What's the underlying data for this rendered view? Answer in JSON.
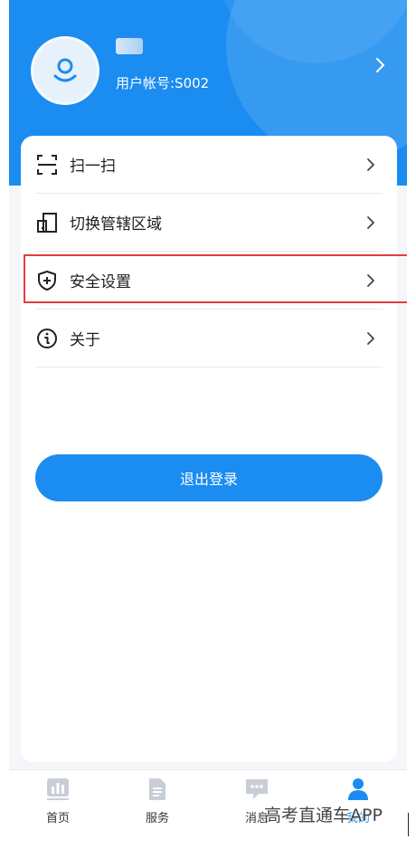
{
  "profile": {
    "account_label": "用户帐号:S002"
  },
  "menu": {
    "items": [
      {
        "label": "扫一扫",
        "icon": "scan-icon"
      },
      {
        "label": "切换管辖区域",
        "icon": "switch-area-icon"
      },
      {
        "label": "安全设置",
        "icon": "shield-plus-icon"
      },
      {
        "label": "关于",
        "icon": "info-icon"
      }
    ]
  },
  "logout_label": "退出登录",
  "tabbar": {
    "tabs": [
      {
        "label": "首页",
        "icon": "chart-icon",
        "active": false
      },
      {
        "label": "服务",
        "icon": "document-icon",
        "active": false
      },
      {
        "label": "消息",
        "icon": "chat-icon",
        "active": false
      },
      {
        "label": "我的",
        "icon": "person-icon",
        "active": true
      }
    ]
  },
  "watermark": "高考直通车APP",
  "colors": {
    "primary": "#1b8cf0",
    "highlight_border": "#e43d3d",
    "background": "#f4f6f9"
  }
}
